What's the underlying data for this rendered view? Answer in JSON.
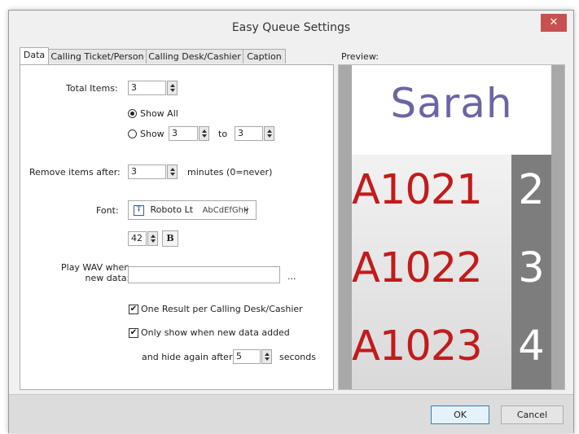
{
  "window": {
    "title": "Easy Queue Settings",
    "close_glyph": "✕"
  },
  "tabs": [
    "Data",
    "Calling Ticket/Person",
    "Calling Desk/Cashier",
    "Caption"
  ],
  "data_tab": {
    "total_items_label": "Total Items:",
    "total_items_value": "3",
    "show_all_label": "Show All",
    "show_label": "Show",
    "show_from": "3",
    "to_label": "to",
    "show_to": "3",
    "remove_label": "Remove items after:",
    "remove_value": "3",
    "remove_suffix": "minutes (0=never)",
    "font_label": "Font:",
    "font_icon_glyph": "Ŧ",
    "font_name": "Roboto Lt",
    "font_sample": "AbCdEfGhIj",
    "font_chevron": "⌄",
    "font_size": "42",
    "bold_glyph": "B",
    "wav_label_line1": "Play WAV when",
    "wav_label_line2": "new data:",
    "wav_value": "",
    "ellipsis": "...",
    "one_result_label": "One Result per Calling Desk/Cashier",
    "one_result_checked": true,
    "only_show_label": "Only show when new data added",
    "only_show_checked": true,
    "hide_label": "and hide again after",
    "hide_value": "5",
    "hide_suffix": "seconds",
    "check_glyph": "✔"
  },
  "preview": {
    "label": "Preview:",
    "caption": "Sarah",
    "rows": [
      {
        "ticket": "A1021",
        "desk": "2"
      },
      {
        "ticket": "A1022",
        "desk": "3"
      },
      {
        "ticket": "A1023",
        "desk": "4"
      }
    ],
    "colors": {
      "caption": "#6b65a4",
      "ticket": "#c21b1b",
      "desk_bg": "#7d7d7d",
      "desk_text": "#ffffff",
      "side": "#a8a8a8",
      "row_bg": "#e6e6e6"
    }
  },
  "footer": {
    "ok_label": "OK",
    "cancel_label": "Cancel"
  }
}
